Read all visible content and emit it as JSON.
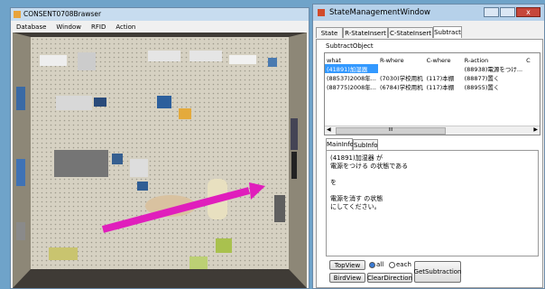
{
  "left_window": {
    "title": "CONSENT0708Brawser",
    "menu": [
      "Database",
      "Window",
      "RFID",
      "Action"
    ]
  },
  "right_window": {
    "title": "StateManagementWindow",
    "tabs": [
      "State",
      "R-StateInsert",
      "C-StateInsert",
      "Subtract"
    ],
    "group_label": "SubtractObject",
    "columns": [
      "what",
      "R-where",
      "C-where",
      "R-action",
      "C"
    ],
    "rows": [
      [
        "(41891)加湿器",
        "",
        "",
        "(88938)電源をつけ..."
      ],
      [
        "(88537)2008年...",
        "(7030)学校用机",
        "(117)本棚",
        "(88877)置く"
      ],
      [
        "(88775)2008年...",
        "(6784)学校用机",
        "(117)本棚",
        "(88955)置く"
      ]
    ],
    "scroll_mark": "III",
    "inner_tabs": [
      "MainInfo",
      "SubInfo"
    ],
    "info_lines": [
      "(41891)加湿器 が",
      "電源をつける の状態である",
      "",
      "を",
      "",
      "電源を消す の状態",
      "にしてください。"
    ],
    "buttons": {
      "top_view": "TopView",
      "bird_view": "BirdView",
      "clear_direction": "ClearDirection",
      "get_subtraction": "GetSubtraction"
    },
    "radios": {
      "all": "all",
      "each": "each"
    }
  }
}
